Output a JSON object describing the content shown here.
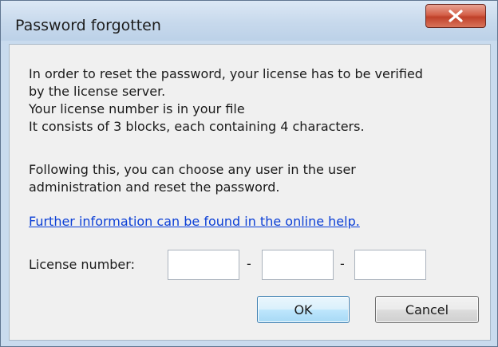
{
  "window": {
    "title": "Password forgotten",
    "close_glyph": "X"
  },
  "body": {
    "paragraph1": [
      "In order to reset the password, your license has to be verified",
      "by the license server.",
      "Your license number is in your file",
      "It consists of 3 blocks, each containing 4 characters."
    ],
    "paragraph2": [
      "Following this, you can choose any user in the user",
      "administration and reset the password."
    ],
    "help_link": "Further information can be found in the online help."
  },
  "license": {
    "label": "License number:",
    "separator": "-",
    "block1_value": "",
    "block2_value": "",
    "block3_value": ""
  },
  "buttons": {
    "ok_label": "OK",
    "cancel_label": "Cancel"
  },
  "colors": {
    "link": "#0b3fd6",
    "close_button": "#c0412a",
    "titlebar": "#c7d9ec"
  }
}
